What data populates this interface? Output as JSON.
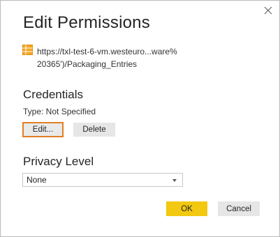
{
  "dialog": {
    "title": "Edit Permissions",
    "close_icon": "close-icon",
    "source": {
      "icon": "table-icon",
      "icon_color": "#f5a623",
      "line1": "https://txl-test-6-vm.westeuro...ware%",
      "line2": "20365')/Packaging_Entries"
    },
    "credentials": {
      "heading": "Credentials",
      "type_text": "Type: Not Specified",
      "edit_label": "Edit...",
      "delete_label": "Delete"
    },
    "privacy": {
      "heading": "Privacy Level",
      "selected": "None"
    },
    "footer": {
      "ok_label": "OK",
      "cancel_label": "Cancel"
    },
    "colors": {
      "accent_yellow": "#f2c811",
      "focus_orange": "#e27e24",
      "button_gray": "#e6e6e6"
    }
  }
}
